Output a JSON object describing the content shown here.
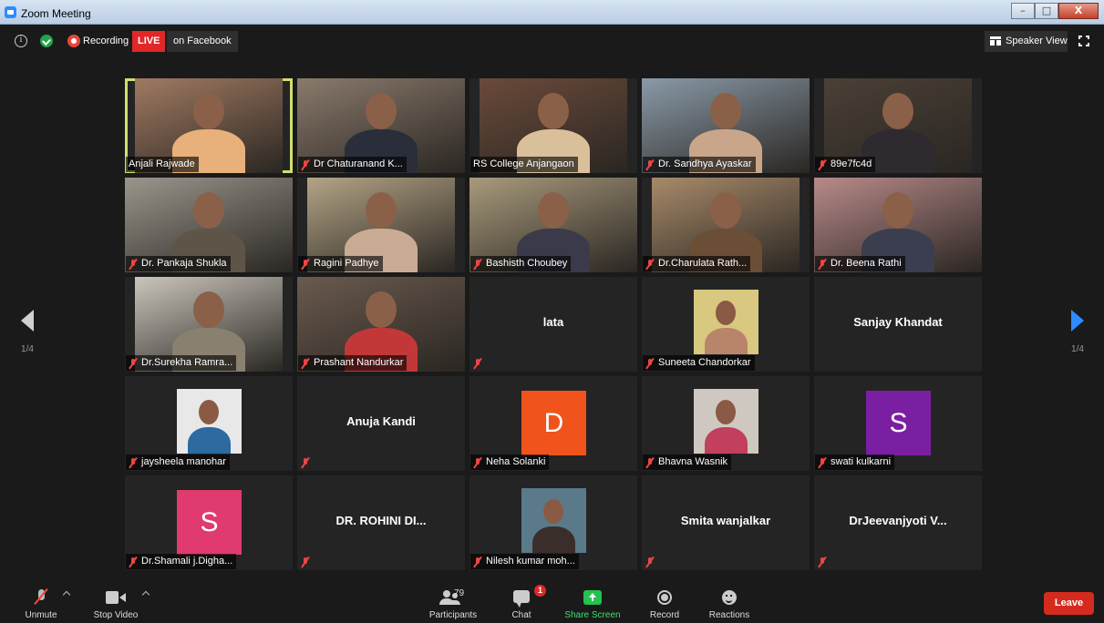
{
  "window": {
    "title": "Zoom Meeting",
    "minimize": "–",
    "maximize": "□",
    "close": "X"
  },
  "topbar": {
    "recording": "Recording",
    "live": "LIVE",
    "live_target": "on Facebook",
    "view": "Speaker View"
  },
  "pager": {
    "prev_page": "1/4",
    "next_page": "1/4"
  },
  "tiles": [
    {
      "name": "Anjali Rajwade",
      "kind": "video",
      "active": true,
      "muted": false,
      "bg": "#a07a62",
      "fg": "#e8b07a"
    },
    {
      "name": "Dr Chaturanand K...",
      "kind": "video",
      "muted": true,
      "bg": "#8a7a6c",
      "fg": "#2a2e3a"
    },
    {
      "name": "RS College Anjangaon",
      "kind": "video",
      "muted": false,
      "bg": "#6a4a3a",
      "fg": "#d9c09a"
    },
    {
      "name": "Dr. Sandhya Ayaskar",
      "kind": "video",
      "muted": true,
      "bg": "#8a9aa8",
      "fg": "#c9a68a"
    },
    {
      "name": "89e7fc4d",
      "kind": "video",
      "muted": true,
      "bg": "#4a4036",
      "fg": "#2e2a30"
    },
    {
      "name": "Dr. Pankaja Shukla",
      "kind": "video",
      "muted": true,
      "bg": "#9a968c",
      "fg": "#5e5448"
    },
    {
      "name": "Ragini Padhye",
      "kind": "video",
      "muted": true,
      "bg": "#b4a486",
      "fg": "#c9ab94"
    },
    {
      "name": "Bashisth Choubey",
      "kind": "video",
      "muted": true,
      "bg": "#a89a7c",
      "fg": "#3a3a4a"
    },
    {
      "name": "Dr.Charulata  Rath...",
      "kind": "video",
      "muted": true,
      "bg": "#a88a6a",
      "fg": "#6a4e36"
    },
    {
      "name": "Dr. Beena Rathi",
      "kind": "video",
      "muted": true,
      "bg": "#b88a8a",
      "fg": "#3a3e4e"
    },
    {
      "name": "Dr.Surekha Ramra...",
      "kind": "video",
      "muted": true,
      "bg": "#cac6bc",
      "fg": "#8a8070"
    },
    {
      "name": "Prashant Nandurkar",
      "kind": "video",
      "muted": true,
      "bg": "#6a5a4e",
      "fg": "#c23838"
    },
    {
      "name": "lata",
      "kind": "text",
      "muted": true
    },
    {
      "name": "Suneeta Chandorkar",
      "kind": "photo",
      "muted": true,
      "bg": "#d9c880",
      "fg": "#b9856a"
    },
    {
      "name": "Sanjay Khandat",
      "kind": "text",
      "muted": false
    },
    {
      "name": "jaysheela manohar",
      "kind": "photo",
      "muted": true,
      "bg": "#e8e8e8",
      "fg": "#2c6aa0"
    },
    {
      "name": "Anuja Kandi",
      "kind": "text",
      "muted": true
    },
    {
      "name": "Neha Solanki",
      "kind": "initial",
      "letter": "D",
      "color": "#f0531c",
      "muted": true
    },
    {
      "name": "Bhavna Wasnik",
      "kind": "photo",
      "muted": true,
      "bg": "#cfc8c0",
      "fg": "#c23f5e"
    },
    {
      "name": "swati kulkarni",
      "kind": "initial",
      "letter": "S",
      "color": "#7b1fa2",
      "muted": true
    },
    {
      "name": "Dr.Shamali j.Digha...",
      "kind": "initial",
      "letter": "S",
      "color": "#e03a6e",
      "muted": true
    },
    {
      "name": "DR. ROHINI DI...",
      "kind": "text",
      "muted": true
    },
    {
      "name": "Nilesh kumar moh...",
      "kind": "photo",
      "muted": true,
      "bg": "#5a7a8a",
      "fg": "#3a2e2a"
    },
    {
      "name": "Smita wanjalkar",
      "kind": "text",
      "muted": true
    },
    {
      "name": "DrJeevanjyoti  V...",
      "kind": "text",
      "muted": true
    }
  ],
  "toolbar": {
    "unmute": "Unmute",
    "stop_video": "Stop Video",
    "participants": "Participants",
    "participants_count": "79",
    "chat": "Chat",
    "chat_badge": "1",
    "share_screen": "Share Screen",
    "record": "Record",
    "reactions": "Reactions",
    "leave": "Leave"
  }
}
